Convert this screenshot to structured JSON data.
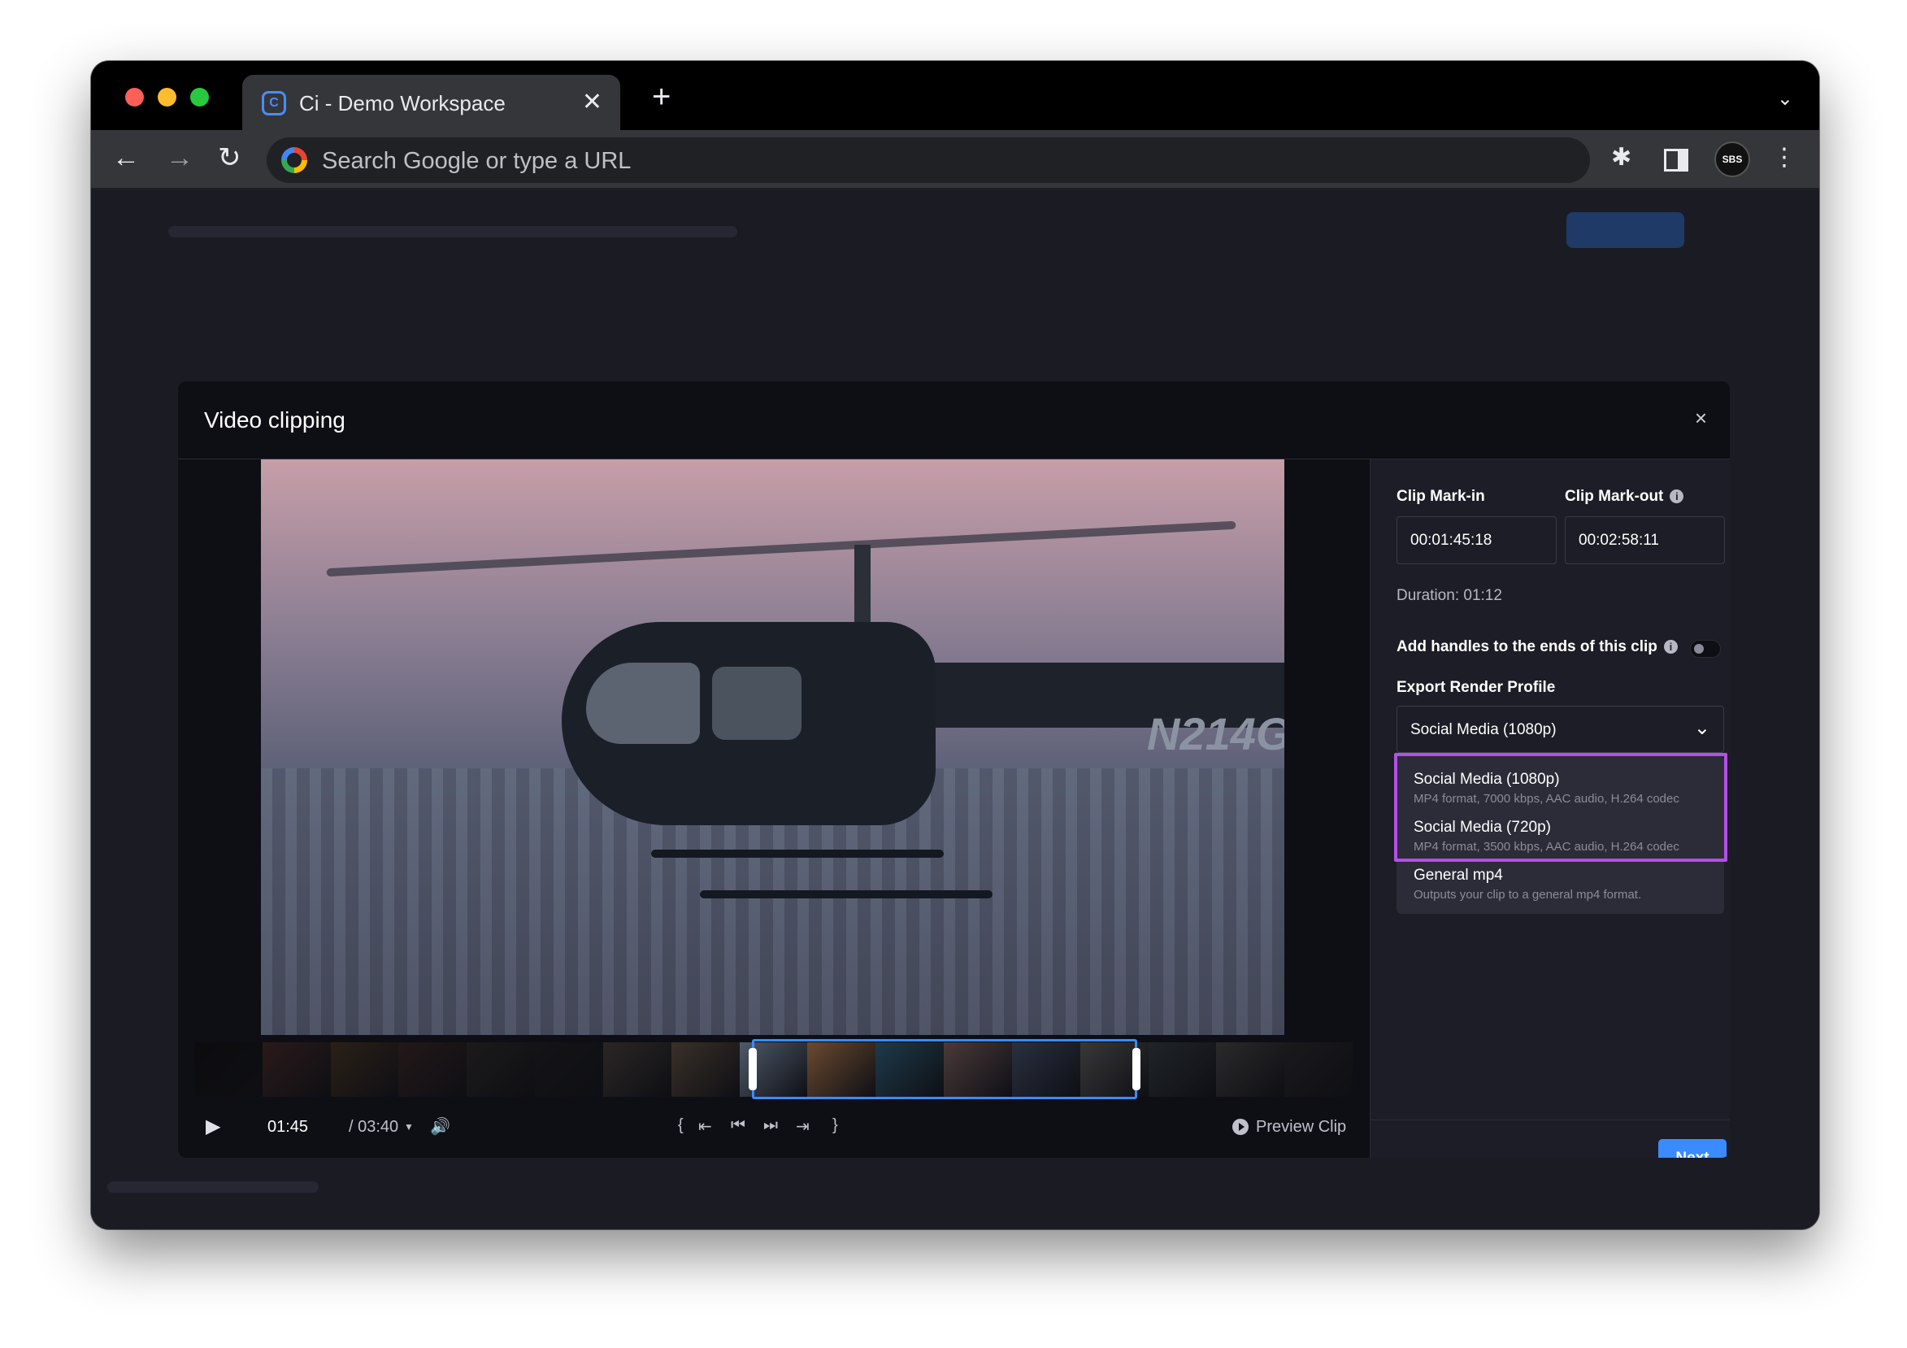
{
  "browser": {
    "tab_title": "Ci - Demo Workspace",
    "tab_close": "✕",
    "new_tab": "+",
    "tab_list": "⌄",
    "omnibox_placeholder": "Search Google or type a URL",
    "nav_back": "←",
    "nav_forward": "→",
    "nav_reload": "↻",
    "extensions": "✱",
    "menu": "⋮",
    "avatar_text": "SBS"
  },
  "modal": {
    "title": "Video clipping",
    "close": "×"
  },
  "video": {
    "overlay_text": "N214G"
  },
  "player": {
    "play": "▶",
    "current_time": "01:45",
    "total_time": "/ 03:40",
    "caret": "▼",
    "volume": "🔊",
    "mark_in": "{",
    "go_to_in": "⇤",
    "prev_frame": "⏮",
    "next_frame": "⏭",
    "go_to_out": "⇥",
    "mark_out": "}",
    "preview_clip": "Preview Clip"
  },
  "filmstrip_colors": [
    "#0c0c0e",
    "#2a1a1a",
    "#2b2016",
    "#231818",
    "#1c1a1a",
    "#141416",
    "#2a2624",
    "#3a3028",
    "#4f5a6a",
    "#6a4a30",
    "#1e3a4a",
    "#4a3a3a",
    "#2a3040",
    "#383838",
    "#202428",
    "#2a2a2a",
    "#1a1a1c"
  ],
  "panel": {
    "mark_in_label": "Clip Mark-in",
    "mark_out_label": "Clip Mark-out",
    "info": "i",
    "mark_in_value": "00:01:45:18",
    "mark_out_value": "00:02:58:11",
    "duration": "Duration: 01:12",
    "handles_label": "Add handles to the ends of this clip",
    "handles_enabled": false,
    "render_profile_label": "Export Render Profile",
    "selected_profile": "Social Media (1080p)",
    "chevron": "⌄",
    "options": [
      {
        "label": "Social Media (1080p)",
        "desc": "MP4 format, 7000 kbps, AAC audio, H.264 codec"
      },
      {
        "label": "Social Media (720p)",
        "desc": "MP4 format, 3500 kbps, AAC audio, H.264 codec"
      },
      {
        "label": "General mp4",
        "desc": "Outputs your clip to a general mp4 format."
      }
    ],
    "highlight_color": "#b44fe8",
    "next_label": "Next",
    "accent": "#3a8bff"
  }
}
